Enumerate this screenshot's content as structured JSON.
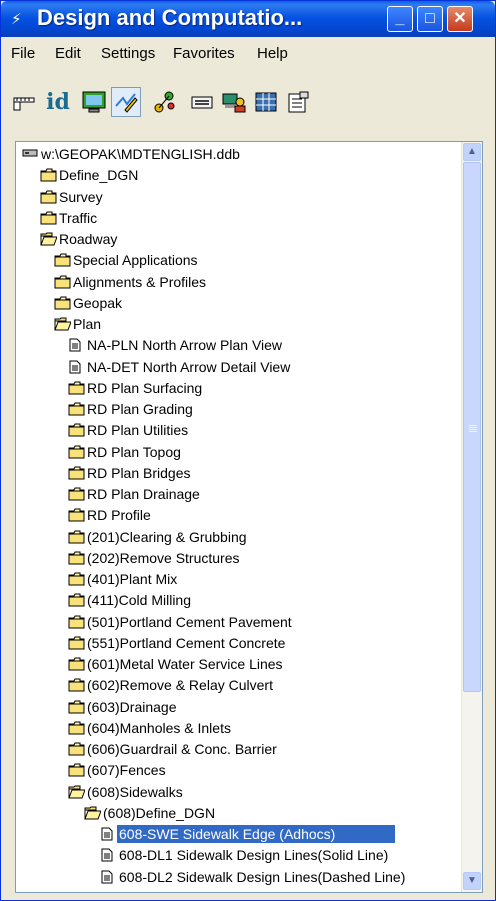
{
  "window": {
    "title": "Design and Computatio..."
  },
  "menubar": [
    "File",
    "Edit",
    "Settings",
    "Favorites",
    "Help"
  ],
  "toolbar": [
    {
      "name": "ruler-icon"
    },
    {
      "name": "id-icon",
      "text": "id"
    },
    {
      "name": "monitor-icon"
    },
    {
      "name": "design-pencil-icon"
    },
    {
      "name": "network-icon"
    },
    {
      "name": "keyboard-icon"
    },
    {
      "name": "computer-user-icon"
    },
    {
      "name": "spreadsheet-icon"
    },
    {
      "name": "properties-icon"
    }
  ],
  "tree": [
    {
      "indent": 0,
      "icon": "drive",
      "label": "w:\\GEOPAK\\MDTENGLISH.ddb"
    },
    {
      "indent": 1,
      "icon": "folder-closed",
      "label": "Define_DGN"
    },
    {
      "indent": 1,
      "icon": "folder-closed",
      "label": "Survey"
    },
    {
      "indent": 1,
      "icon": "folder-closed",
      "label": "Traffic"
    },
    {
      "indent": 1,
      "icon": "folder-open",
      "label": "Roadway"
    },
    {
      "indent": 2,
      "icon": "folder-closed",
      "label": "Special Applications"
    },
    {
      "indent": 2,
      "icon": "folder-closed",
      "label": "Alignments & Profiles"
    },
    {
      "indent": 2,
      "icon": "folder-closed",
      "label": "Geopak"
    },
    {
      "indent": 2,
      "icon": "folder-open",
      "label": "Plan"
    },
    {
      "indent": 3,
      "icon": "document",
      "label": "NA-PLN North Arrow Plan View"
    },
    {
      "indent": 3,
      "icon": "document",
      "label": "NA-DET North Arrow Detail View"
    },
    {
      "indent": 3,
      "icon": "folder-closed",
      "label": "RD Plan Surfacing"
    },
    {
      "indent": 3,
      "icon": "folder-closed",
      "label": "RD Plan Grading"
    },
    {
      "indent": 3,
      "icon": "folder-closed",
      "label": "RD Plan Utilities"
    },
    {
      "indent": 3,
      "icon": "folder-closed",
      "label": "RD Plan Topog"
    },
    {
      "indent": 3,
      "icon": "folder-closed",
      "label": "RD Plan Bridges"
    },
    {
      "indent": 3,
      "icon": "folder-closed",
      "label": "RD Plan Drainage"
    },
    {
      "indent": 3,
      "icon": "folder-closed",
      "label": "RD Profile"
    },
    {
      "indent": 3,
      "icon": "folder-closed",
      "label": "(201)Clearing & Grubbing"
    },
    {
      "indent": 3,
      "icon": "folder-closed",
      "label": "(202)Remove Structures"
    },
    {
      "indent": 3,
      "icon": "folder-closed",
      "label": "(401)Plant Mix"
    },
    {
      "indent": 3,
      "icon": "folder-closed",
      "label": "(411)Cold Milling"
    },
    {
      "indent": 3,
      "icon": "folder-closed",
      "label": "(501)Portland Cement Pavement"
    },
    {
      "indent": 3,
      "icon": "folder-closed",
      "label": "(551)Portland Cement Concrete"
    },
    {
      "indent": 3,
      "icon": "folder-closed",
      "label": "(601)Metal Water Service Lines"
    },
    {
      "indent": 3,
      "icon": "folder-closed",
      "label": "(602)Remove & Relay Culvert"
    },
    {
      "indent": 3,
      "icon": "folder-closed",
      "label": "(603)Drainage"
    },
    {
      "indent": 3,
      "icon": "folder-closed",
      "label": "(604)Manholes & Inlets"
    },
    {
      "indent": 3,
      "icon": "folder-closed",
      "label": "(606)Guardrail & Conc. Barrier"
    },
    {
      "indent": 3,
      "icon": "folder-closed",
      "label": "(607)Fences"
    },
    {
      "indent": 3,
      "icon": "folder-open",
      "label": "(608)Sidewalks"
    },
    {
      "indent": 4,
      "icon": "folder-open",
      "label": "(608)Define_DGN"
    },
    {
      "indent": 5,
      "icon": "document",
      "label": "608-SWE Sidewalk Edge (Adhocs)",
      "selected": true
    },
    {
      "indent": 5,
      "icon": "document",
      "label": "608-DL1 Sidewalk Design Lines(Solid Line)"
    },
    {
      "indent": 5,
      "icon": "document",
      "label": "608-DL2 Sidewalk Design Lines(Dashed Line)"
    }
  ],
  "colors": {
    "selection": "#316ac5",
    "titlebar": "#0553e1",
    "folder": "#d4a017"
  }
}
